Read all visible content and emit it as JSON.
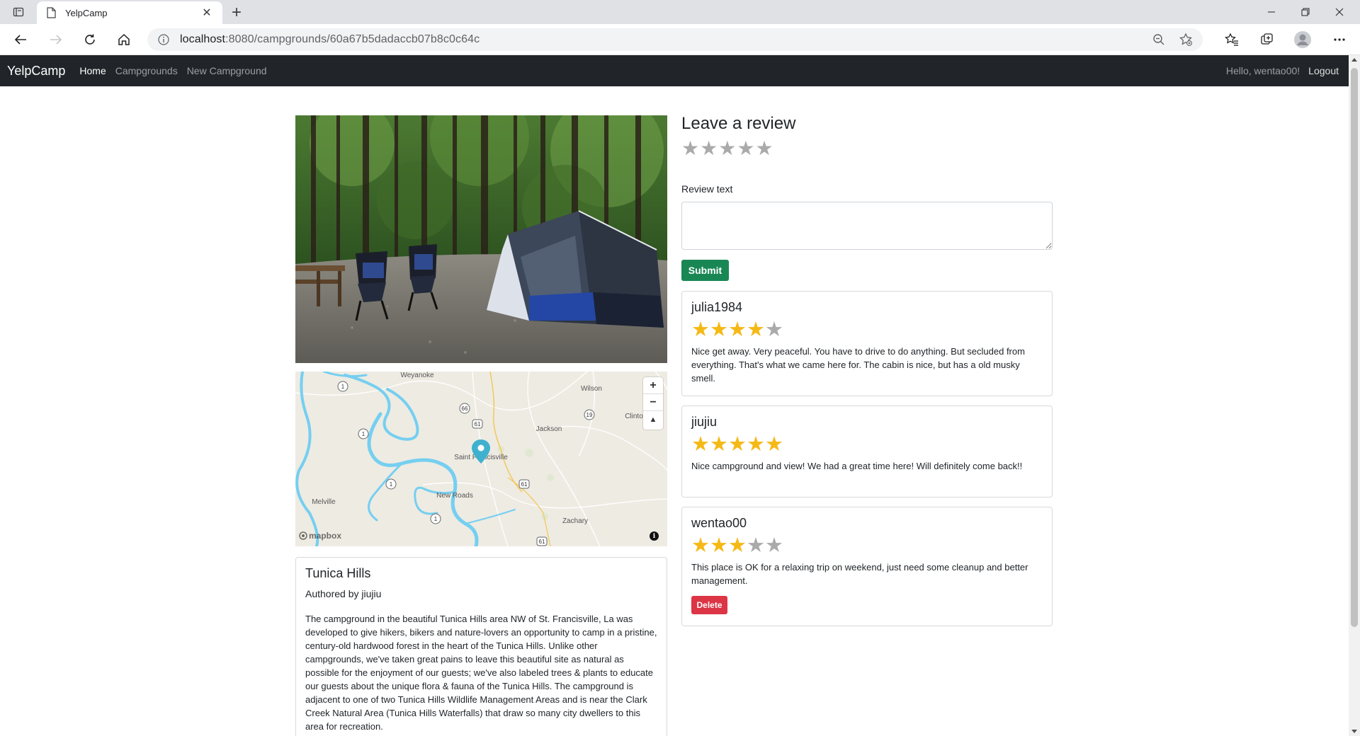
{
  "browser": {
    "tab_title": "YelpCamp",
    "url_host": "localhost",
    "url_path": ":8080/campgrounds/60a67b5dadaccb07b8c0c64c"
  },
  "navbar": {
    "brand": "YelpCamp",
    "links": [
      "Home",
      "Campgrounds",
      "New Campground"
    ],
    "greeting": "Hello, wentao00!",
    "logout": "Logout"
  },
  "map": {
    "attribution": "mapbox",
    "zoom_in": "+",
    "zoom_out": "−",
    "compass": "▲",
    "places": [
      "Weyanoke",
      "Wilson",
      "Jackson",
      "Clinto",
      "Saint Francisville",
      "New Roads",
      "Melville",
      "Zachary"
    ],
    "route_shields": [
      "1",
      "1",
      "1",
      "1",
      "66",
      "61",
      "61",
      "19",
      "61"
    ]
  },
  "campground": {
    "title": "Tunica Hills",
    "author": "Authored by jiujiu",
    "description": "The campground in the beautiful Tunica Hills area NW of St. Francisville, La was developed to give hikers, bikers and nature-lovers an opportunity to camp in a pristine, century-old hardwood forest in the heart of the Tunica Hills. Unlike other campgrounds, we've taken great pains to leave this beautiful site as natural as possible for the enjoyment of our guests; we've also labeled trees & plants to educate our guests about the unique flora & fauna of the Tunica Hills. The campground is adjacent to one of two Tunica Hills Wildlife Management Areas and is near the Clark Creek Natural Area (Tunica Hills Waterfalls) that draw so many city dwellers to this area for recreation."
  },
  "review_form": {
    "heading": "Leave a review",
    "rating": 0,
    "label": "Review text",
    "value": "",
    "submit": "Submit"
  },
  "reviews": [
    {
      "author": "julia1984",
      "rating": 4,
      "body": "Nice get away. Very peaceful. You have to drive to do anything. But secluded from everything. That's what we came here for. The cabin is nice, but has a old musky smell."
    },
    {
      "author": "jiujiu",
      "rating": 5,
      "body": "Nice campground and view! We had a great time here! Will definitely come back!!"
    },
    {
      "author": "wentao00",
      "rating": 3,
      "body": "This place is OK for a relaxing trip on weekend, just need some cleanup and better management.",
      "delete": "Delete"
    }
  ],
  "colors": {
    "navbar_bg": "#212529",
    "star_filled": "#f5b916",
    "star_empty": "#aaaaaa",
    "submit_bg": "#198754",
    "delete_bg": "#dc3545",
    "map_marker": "#3fb1ce",
    "map_water": "#75cff0"
  }
}
